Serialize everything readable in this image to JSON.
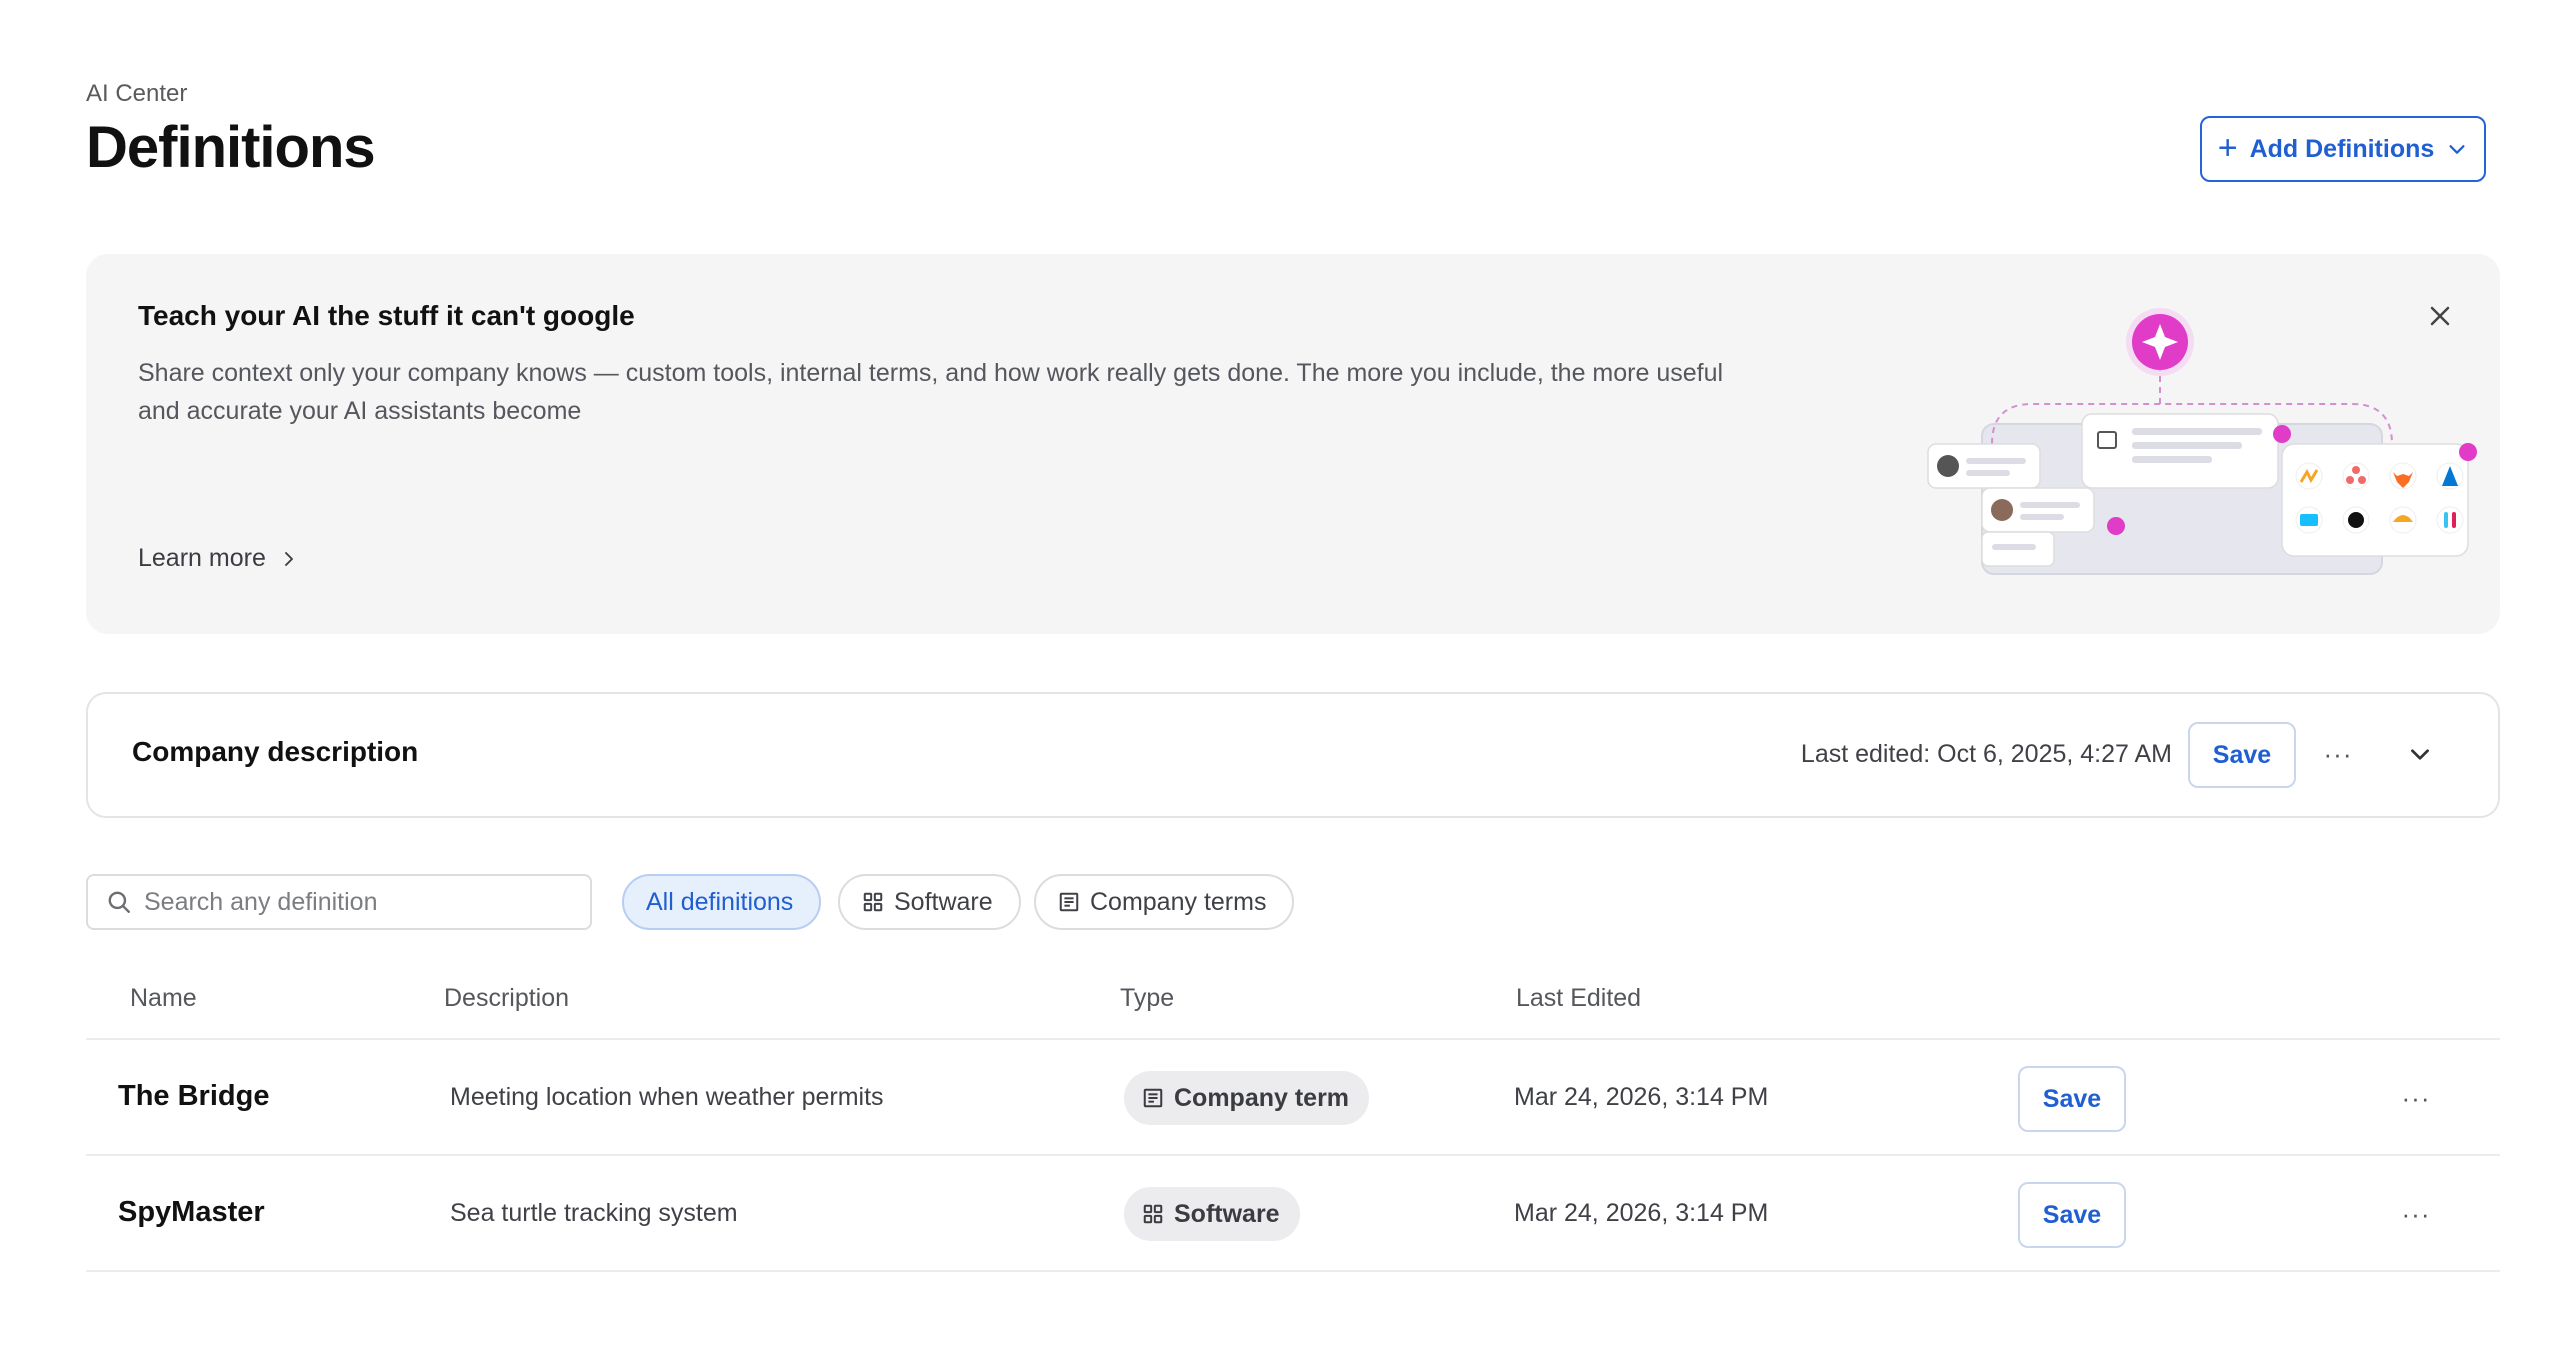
{
  "header": {
    "breadcrumb": "AI Center",
    "title": "Definitions",
    "add_button_label": "Add Definitions"
  },
  "banner": {
    "title": "Teach your AI the stuff it can't google",
    "text": "Share context only your company knows — custom tools, internal terms, and how work really gets done. The more you include, the more useful and accurate your AI assistants become",
    "learn_more": "Learn more"
  },
  "company": {
    "title": "Company description",
    "last_edited": "Last edited: Oct 6, 2025, 4:27 AM",
    "save_label": "Save"
  },
  "filters": {
    "search_placeholder": "Search any definition",
    "chips": [
      "All definitions",
      "Software",
      "Company terms"
    ],
    "active": "All definitions"
  },
  "table": {
    "columns": [
      "Name",
      "Description",
      "Type",
      "Last Edited"
    ],
    "rows": [
      {
        "name": "The Bridge",
        "description": "Meeting location when weather permits",
        "type": "Company term",
        "type_icon": "document-icon",
        "last_edited": "Mar 24, 2026, 3:14 PM",
        "save_label": "Save"
      },
      {
        "name": "SpyMaster",
        "description": "Sea turtle tracking system",
        "type": "Software",
        "type_icon": "grid-icon",
        "last_edited": "Mar 24, 2026, 3:14 PM",
        "save_label": "Save"
      }
    ]
  },
  "colors": {
    "accent": "#1f5fd1",
    "banner_bg": "#f5f5f6",
    "sparkle": "#e040c8"
  }
}
